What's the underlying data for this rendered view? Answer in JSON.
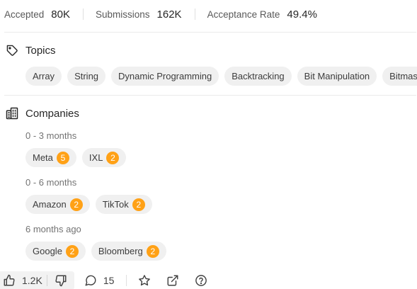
{
  "stats": {
    "accepted": {
      "label": "Accepted",
      "value": "80K"
    },
    "submissions": {
      "label": "Submissions",
      "value": "162K"
    },
    "acceptance_rate": {
      "label": "Acceptance Rate",
      "value": "49.4%"
    }
  },
  "topics": {
    "title": "Topics",
    "items": [
      "Array",
      "String",
      "Dynamic Programming",
      "Backtracking",
      "Bit Manipulation",
      "Bitmask"
    ]
  },
  "companies": {
    "title": "Companies",
    "groups": [
      {
        "period": "0 - 3 months",
        "items": [
          {
            "name": "Meta",
            "count": "5"
          },
          {
            "name": "IXL",
            "count": "2"
          }
        ]
      },
      {
        "period": "0 - 6 months",
        "items": [
          {
            "name": "Amazon",
            "count": "2"
          },
          {
            "name": "TikTok",
            "count": "2"
          }
        ]
      },
      {
        "period": "6 months ago",
        "items": [
          {
            "name": "Google",
            "count": "2"
          },
          {
            "name": "Bloomberg",
            "count": "2"
          }
        ]
      }
    ]
  },
  "actions": {
    "likes": "1.2K",
    "comments": "15",
    "icons": [
      "thumbs-up-icon",
      "thumbs-down-icon",
      "comment-icon",
      "star-icon",
      "share-icon",
      "help-icon"
    ]
  },
  "colors": {
    "badge": "#ffa116",
    "pill_bg": "#f0f0f0"
  }
}
